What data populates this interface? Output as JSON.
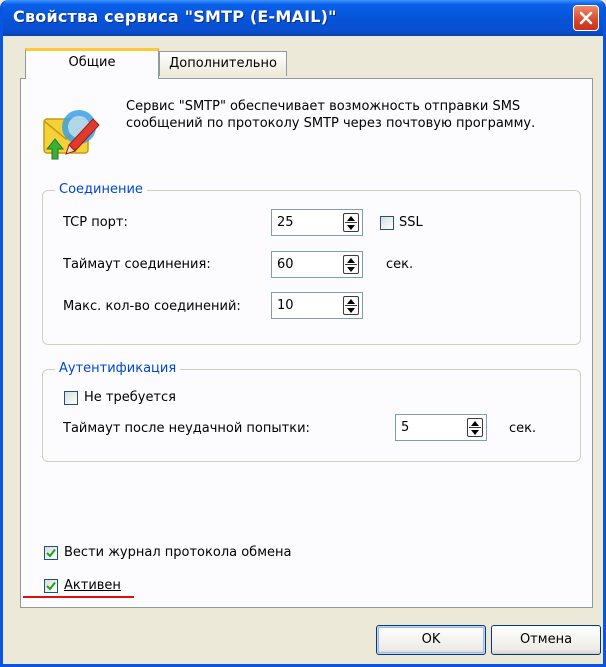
{
  "window": {
    "title": "Свойства сервиса \"SMTP (E-MAIL)\"",
    "title_color": "#ffffff",
    "accent": "#0a55e0"
  },
  "tabs": [
    {
      "label": "Общие",
      "active": true
    },
    {
      "label": "Дополнительно",
      "active": false
    }
  ],
  "description": "Сервис \"SMTP\" обеспечивает возможность отправки SMS сообщений по протоколу SMTP через почтовую программу.",
  "connection": {
    "title": "Соединение",
    "tcp_port_label": "TCP порт:",
    "tcp_port_value": "25",
    "ssl_label": "SSL",
    "ssl_checked": false,
    "timeout_label": "Таймаут соединения:",
    "timeout_value": "60",
    "timeout_unit": "сек.",
    "max_conn_label": "Макс. кол-во соединений:",
    "max_conn_value": "10"
  },
  "auth": {
    "title": "Аутентификация",
    "not_required_label": "Не требуется",
    "not_required_checked": false,
    "fail_timeout_label": "Таймаут после неудачной попытки:",
    "fail_timeout_value": "5",
    "fail_timeout_unit": "сек."
  },
  "options": {
    "log_label": "Вести журнал протокола обмена",
    "log_checked": true,
    "active_label": "Активен",
    "active_checked": true
  },
  "buttons": {
    "ok": "OK",
    "cancel": "Отмена"
  },
  "icons": {
    "service": "mail-envelope-pen-icon",
    "close": "close-icon",
    "spin": "spin-updown-icon",
    "check": "checkmark-icon"
  },
  "colors": {
    "group_title": "#0046d5",
    "tab_highlight": "#ffc83c",
    "annotation": "#e01010"
  }
}
